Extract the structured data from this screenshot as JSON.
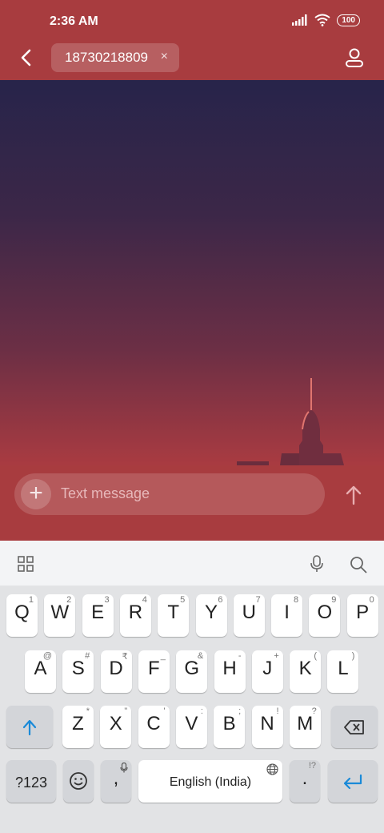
{
  "status_bar": {
    "time": "2:36 AM",
    "battery": "100",
    "signal_icon": "signal-icon",
    "wifi_icon": "wifi-icon"
  },
  "header": {
    "back_icon": "back-arrow-icon",
    "recipient": "18730218809",
    "remove_icon": "×",
    "profile_icon": "person-icon"
  },
  "composer": {
    "plus_icon": "+",
    "placeholder": "Text message",
    "send_icon": "arrow-up-icon"
  },
  "keyboard_toolbar": {
    "apps_icon": "grid-icon",
    "mic_icon": "mic-icon",
    "search_icon": "search-icon"
  },
  "keyboard": {
    "row1": [
      {
        "label": "Q",
        "hint": "1"
      },
      {
        "label": "W",
        "hint": "2"
      },
      {
        "label": "E",
        "hint": "3"
      },
      {
        "label": "R",
        "hint": "4"
      },
      {
        "label": "T",
        "hint": "5"
      },
      {
        "label": "Y",
        "hint": "6"
      },
      {
        "label": "U",
        "hint": "7"
      },
      {
        "label": "I",
        "hint": "8"
      },
      {
        "label": "O",
        "hint": "9"
      },
      {
        "label": "P",
        "hint": "0"
      }
    ],
    "row2": [
      {
        "label": "A",
        "hint": "@"
      },
      {
        "label": "S",
        "hint": "#"
      },
      {
        "label": "D",
        "hint": "₹"
      },
      {
        "label": "F",
        "hint": "_"
      },
      {
        "label": "G",
        "hint": "&"
      },
      {
        "label": "H",
        "hint": "-"
      },
      {
        "label": "J",
        "hint": "+"
      },
      {
        "label": "K",
        "hint": "("
      },
      {
        "label": "L",
        "hint": ")"
      }
    ],
    "row3": [
      {
        "label": "Z",
        "hint": "*"
      },
      {
        "label": "X",
        "hint": "\""
      },
      {
        "label": "C",
        "hint": "'"
      },
      {
        "label": "V",
        "hint": ":"
      },
      {
        "label": "B",
        "hint": ";"
      },
      {
        "label": "N",
        "hint": "!"
      },
      {
        "label": "M",
        "hint": "?"
      }
    ],
    "shift_icon": "shift-icon",
    "backspace_icon": "backspace-icon",
    "symbols_label": "?123",
    "emoji_icon": "emoji-icon",
    "comma_label": ",",
    "comma_hint_icon": "mic-icon",
    "space_label": "English (India)",
    "space_hint_icon": "globe-icon",
    "period_label": ".",
    "period_hint": "!?",
    "enter_icon": "enter-icon"
  },
  "colors": {
    "app_bar": "#a83c3f",
    "accent_blue": "#1a8ad8"
  }
}
